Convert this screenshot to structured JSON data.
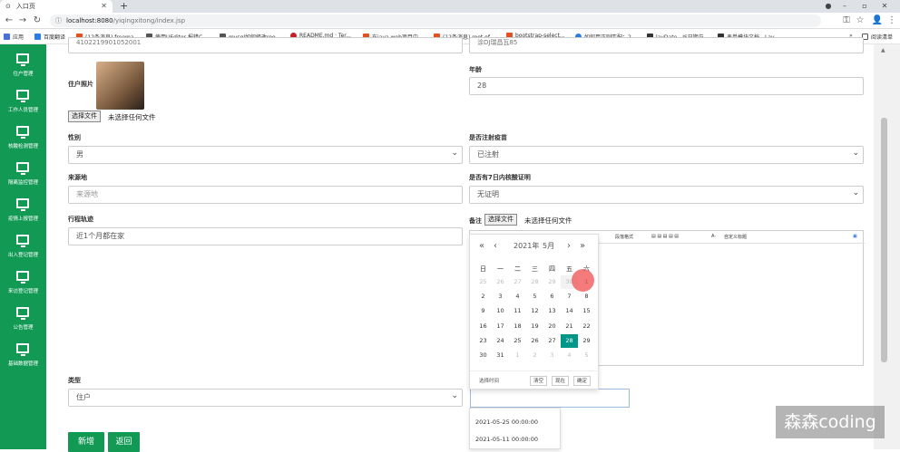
{
  "browser": {
    "tab_title": "入口页",
    "url_host": "localhost:8080",
    "url_path": "/yiqingxitong/index.jsp",
    "bookmarks": [
      "应用",
      "百度翻译",
      "(12条消息) freema...",
      "使用UEditor,报错C...",
      "mysql如何修改roo...",
      "README.md · Ter...",
      "在java web项目中...",
      "(12条消息) root of...",
      "bootstrap-select...",
      "如何用正则匹配：2...",
      "layDate - JS日期与...",
      "表单模块文档 - Lay...",
      "阅读清单"
    ]
  },
  "sidebar": {
    "items": [
      "住户管理",
      "工作人员管理",
      "核酸检测管理",
      "隔离监控管理",
      "疫情上报管理",
      "出入登记管理",
      "来访登记管理",
      "公告管理",
      "基础数据管理"
    ]
  },
  "form": {
    "top_left_value": "4102219901052001",
    "top_right_value": "涂DJ瑞昌瓦85",
    "age_label": "年龄",
    "age_value": "28",
    "photo_label": "住户照片",
    "file_button": "选择文件",
    "file_none": "未选择任何文件",
    "gender_label": "性别",
    "gender_value": "男",
    "vaccine_label": "是否注射疫苗",
    "vaccine_value": "已注射",
    "origin_label": "来源地",
    "origin_placeholder": "来源地",
    "cert_label": "是否有7日内核酸证明",
    "cert_value": "无证明",
    "track_label": "行程轨迹",
    "track_value": "近1个月都在家",
    "note_label": "备注",
    "type_label": "类型",
    "type_value": "住户",
    "add_button": "新增",
    "back_button": "返回"
  },
  "editor": {
    "toolbar": [
      "段落格式",
      "字体",
      "字号",
      "自定义标题"
    ]
  },
  "calendar": {
    "year": "2021年",
    "month": "5月",
    "weekdays": [
      "日",
      "一",
      "二",
      "三",
      "四",
      "五",
      "六"
    ],
    "rows": [
      [
        "25",
        "26",
        "27",
        "28",
        "29",
        "30",
        "1"
      ],
      [
        "2",
        "3",
        "4",
        "5",
        "6",
        "7",
        "8"
      ],
      [
        "9",
        "10",
        "11",
        "12",
        "13",
        "14",
        "15"
      ],
      [
        "16",
        "17",
        "18",
        "19",
        "20",
        "21",
        "22"
      ],
      [
        "23",
        "24",
        "25",
        "26",
        "27",
        "28",
        "29"
      ],
      [
        "30",
        "31",
        "1",
        "2",
        "3",
        "4",
        "5"
      ]
    ],
    "selected": "28",
    "footer_label": "选择时间",
    "clear": "清空",
    "now": "现在",
    "ok": "确定"
  },
  "datetime_options": [
    "2021-05-25 00:00:00",
    "2021-05-11 00:00:00"
  ],
  "watermark": "森森coding",
  "colors": {
    "accent": "#129a55",
    "calendar_selected": "#009688"
  }
}
